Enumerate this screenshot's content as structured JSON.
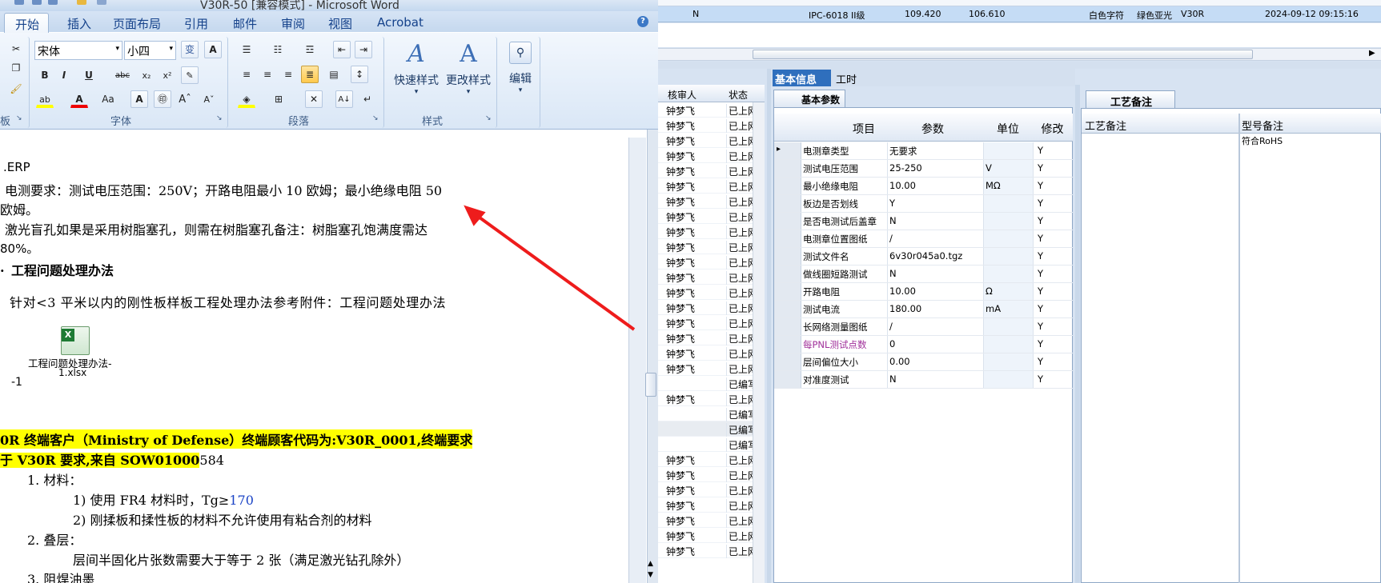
{
  "word": {
    "title": "V30R-50 [兼容模式] - Microsoft Word",
    "tabs": [
      "开始",
      "插入",
      "页面布局",
      "引用",
      "邮件",
      "审阅",
      "视图",
      "Acrobat"
    ],
    "font_name": "宋体",
    "font_size": "小四",
    "groups": {
      "font": "字体",
      "paragraph": "段落",
      "styles": "样式",
      "clipboard": "板"
    },
    "quick_styles": "快速样式",
    "change_styles": "更改样式",
    "edit": "编辑",
    "doc": {
      "l1": ".ERP",
      "l2": "电测要求：测试电压范围：250V；开路电阻最小 10 欧姆；最小绝缘电阻 50",
      "l3": "欧姆。",
      "l4": "激光盲孔如果是采用树脂塞孔，则需在树脂塞孔备注：树脂塞孔饱满度需达",
      "l5": "80%。",
      "l6_num": ".",
      "l6": "工程问题处理办法",
      "l7": "针对<3 平米以内的刚性板样板工程处理办法参考附件：工程问题处理办法",
      "attach_name1": "工程问题处理办法-",
      "attach_name2": "1.xlsx",
      "attach_suffix": "-1",
      "hl1": "0R 终端客户（Ministry of Defense）终端顾客代码为:V30R_0001,终端要求",
      "hl2a": "于 V30R 要求,来自 SOW01000",
      "hl2b": "584",
      "i1": "1. 材料：",
      "i1a": "1) 使用 FR4 材料时，Tg≥",
      "i1a_val": "170",
      "i1b": "2) 刚揉板和揉性板的材料不允许使用有粘合剂的材料",
      "i2": "2. 叠层：",
      "i2a": "层间半固化片张数需要大于等于 2 张（满足激光钻孔除外）",
      "i3": "3. 阻焊油墨"
    }
  },
  "erp": {
    "top_row": {
      "flag": "N",
      "model": "IPC-6018 II级",
      "v1": "109.420",
      "v2": "106.610",
      "char": "白色字符",
      "solder": "绿色亚光",
      "code": "V30R",
      "time": "2024-09-12 09:15:16"
    },
    "list_headers": [
      "核审人",
      "状态"
    ],
    "list_rows": [
      [
        "钟梦飞",
        "已上网"
      ],
      [
        "钟梦飞",
        "已上网"
      ],
      [
        "钟梦飞",
        "已上网"
      ],
      [
        "钟梦飞",
        "已上网"
      ],
      [
        "钟梦飞",
        "已上网"
      ],
      [
        "钟梦飞",
        "已上网"
      ],
      [
        "钟梦飞",
        "已上网"
      ],
      [
        "钟梦飞",
        "已上网"
      ],
      [
        "钟梦飞",
        "已上网"
      ],
      [
        "钟梦飞",
        "已上网"
      ],
      [
        "钟梦飞",
        "已上网"
      ],
      [
        "钟梦飞",
        "已上网"
      ],
      [
        "钟梦飞",
        "已上网"
      ],
      [
        "钟梦飞",
        "已上网"
      ],
      [
        "钟梦飞",
        "已上网"
      ],
      [
        "钟梦飞",
        "已上网"
      ],
      [
        "钟梦飞",
        "已上网"
      ],
      [
        "钟梦飞",
        "已上网"
      ],
      [
        "",
        "已编写"
      ],
      [
        "钟梦飞",
        "已上网"
      ],
      [
        "",
        "已编写"
      ],
      [
        "",
        "已编写"
      ],
      [
        "",
        "已编写"
      ],
      [
        "钟梦飞",
        "已上网"
      ],
      [
        "钟梦飞",
        "已上网"
      ],
      [
        "钟梦飞",
        "已上网"
      ],
      [
        "钟梦飞",
        "已上网"
      ],
      [
        "钟梦飞",
        "已上网"
      ],
      [
        "钟梦飞",
        "已上网"
      ],
      [
        "钟梦飞",
        "已上网"
      ]
    ],
    "tabs": [
      "基本信息",
      "工时"
    ],
    "subtab": "基本参数",
    "grid_headers": [
      "项目",
      "参数",
      "单位",
      "修改"
    ],
    "grid_rows": [
      [
        "电测章类型",
        "无要求",
        "",
        "Y"
      ],
      [
        "测试电压范围",
        "25-250",
        "V",
        "Y"
      ],
      [
        "最小绝缘电阻",
        "10.00",
        "MΩ",
        "Y"
      ],
      [
        "板边是否划线",
        "Y",
        "",
        "Y"
      ],
      [
        "是否电测试后盖章",
        "N",
        "",
        "Y"
      ],
      [
        "电测章位置图纸",
        "/",
        "",
        "Y"
      ],
      [
        "测试文件名",
        "6v30r045a0.tgz",
        "",
        "Y"
      ],
      [
        "做线圈短路测试",
        "N",
        "",
        "Y"
      ],
      [
        "开路电阻",
        "10.00",
        "Ω",
        "Y"
      ],
      [
        "测试电流",
        "180.00",
        "mA",
        "Y"
      ],
      [
        "长网络测量图纸",
        "/",
        "",
        "Y"
      ],
      [
        "每PNL测试点数",
        "0",
        "",
        "Y"
      ],
      [
        "层间偏位大小",
        "0.00",
        "",
        "Y"
      ],
      [
        "对准度测试",
        "N",
        "",
        "Y"
      ]
    ],
    "right_tab": "工艺备注",
    "right_headers": [
      "工艺备注",
      "型号备注"
    ],
    "right_cell": "符合RoHS"
  }
}
